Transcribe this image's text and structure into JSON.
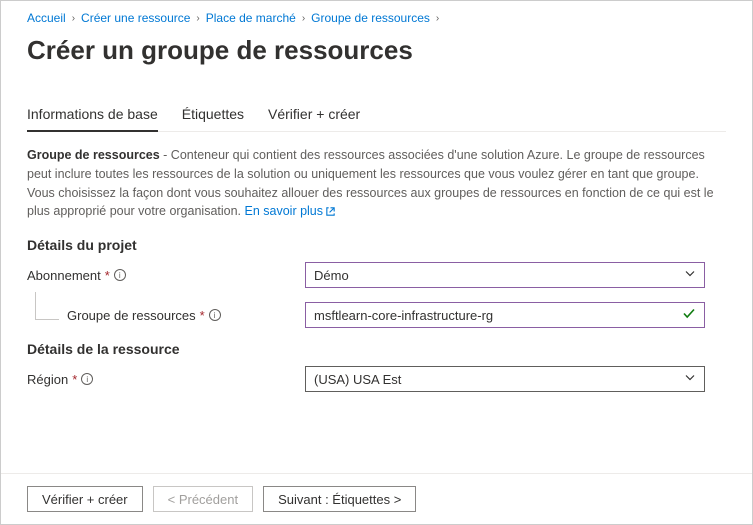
{
  "breadcrumb": {
    "items": [
      {
        "label": "Accueil"
      },
      {
        "label": "Créer une ressource"
      },
      {
        "label": "Place de marché"
      },
      {
        "label": "Groupe de ressources"
      }
    ]
  },
  "title": "Créer un groupe de ressources",
  "tabs": [
    {
      "label": "Informations de base",
      "active": true
    },
    {
      "label": "Étiquettes",
      "active": false
    },
    {
      "label": "Vérifier + créer",
      "active": false
    }
  ],
  "description": {
    "bold_lead": "Groupe de ressources",
    "text": " - Conteneur qui contient des ressources associées d'une solution Azure. Le groupe de ressources peut inclure toutes les ressources de la solution ou uniquement les ressources que vous voulez gérer en tant que groupe. Vous choisissez la façon dont vous souhaitez allouer des ressources aux groupes de ressources en fonction de ce qui est le plus approprié pour votre organisation. ",
    "link": "En savoir plus"
  },
  "sections": {
    "project": {
      "heading": "Détails du projet",
      "subscription_label": "Abonnement",
      "subscription_value": "Démo",
      "rg_label": "Groupe de ressources",
      "rg_value": "msftlearn-core-infrastructure-rg"
    },
    "resource": {
      "heading": "Détails de la ressource",
      "region_label": "Région",
      "region_value": "(USA) USA Est"
    }
  },
  "footer": {
    "review": "Vérifier + créer",
    "previous": "< Précédent",
    "next": "Suivant : Étiquettes >"
  }
}
